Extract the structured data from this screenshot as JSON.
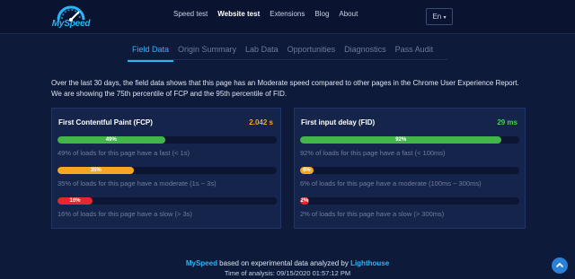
{
  "brand": {
    "name": "MySpeed",
    "color": "#29b6f6"
  },
  "nav": {
    "links": [
      {
        "label": "Speed test",
        "active": false
      },
      {
        "label": "Website test",
        "active": true
      },
      {
        "label": "Extensions",
        "active": false
      },
      {
        "label": "Blog",
        "active": false
      },
      {
        "label": "About",
        "active": false
      }
    ],
    "language": "En",
    "language_icon": "caret-down-icon"
  },
  "tabs": [
    {
      "label": "Field Data",
      "active": true
    },
    {
      "label": "Origin Summary",
      "active": false
    },
    {
      "label": "Lab Data",
      "active": false
    },
    {
      "label": "Opportunities",
      "active": false
    },
    {
      "label": "Diagnostics",
      "active": false
    },
    {
      "label": "Pass Audit",
      "active": false
    }
  ],
  "intro": "Over the last 30 days, the field data shows that this page has an Moderate speed compared to other pages in the Chrome User Experience Report. We are showing the 75th percentile of FCP and the 95th percentile of FID.",
  "cards": [
    {
      "title": "First Contentful Paint (FCP)",
      "value": "2.042 s",
      "value_color": "#f5a623",
      "metrics": [
        {
          "percent": 49,
          "label": "49%",
          "color": "#43b64a",
          "description": "49% of loads for this page have a fast (< 1s)"
        },
        {
          "percent": 35,
          "label": "35%",
          "color": "#f5a623",
          "description": "35% of loads for this page have a moderate (1s ~ 3s)"
        },
        {
          "percent": 16,
          "label": "16%",
          "color": "#e8262f",
          "description": "16% of loads for this page have a slow (> 3s)"
        }
      ]
    },
    {
      "title": "First input delay (FID)",
      "value": "29 ms",
      "value_color": "#43d34a",
      "metrics": [
        {
          "percent": 92,
          "label": "92%",
          "color": "#43b64a",
          "description": "92% of loads for this page have a fast (< 100ms)"
        },
        {
          "percent": 6,
          "label": "6%",
          "color": "#f5a623",
          "description": "6% of loads for this page have a moderate (100ms ~ 300ms)"
        },
        {
          "percent": 2,
          "label": "2%",
          "color": "#e8262f",
          "description": "2% of loads for this page have a slow (> 300ms)"
        }
      ]
    }
  ],
  "footer": {
    "brand": "MySpeed",
    "middle": " based on experimental data analyzed by ",
    "source": "Lighthouse",
    "time": "Time of analysis: 09/15/2020 01:57:12 PM"
  },
  "scroll_top_icon": "chevron-up-icon"
}
